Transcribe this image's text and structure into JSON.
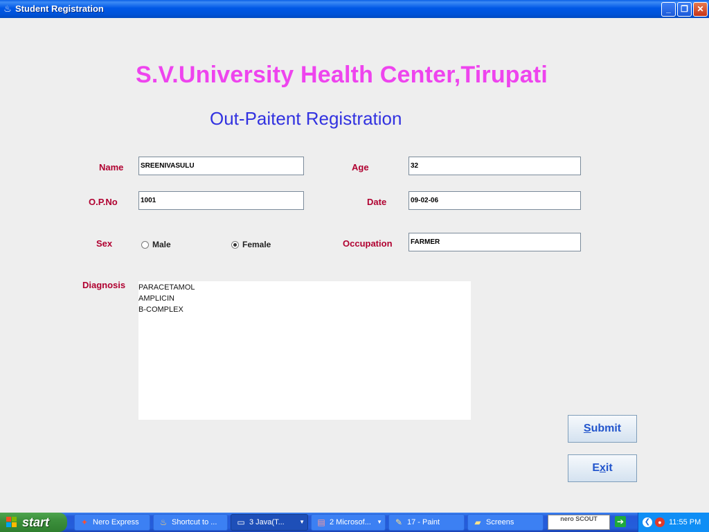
{
  "window": {
    "title": "Student Registration",
    "controls": {
      "minimize": "_",
      "maximize": "❐",
      "close": "✕"
    }
  },
  "form": {
    "heading": "S.V.University Health Center,Tirupati",
    "subheading": "Out-Paitent Registration",
    "labels": {
      "name": "Name",
      "age": "Age",
      "opno": "O.P.No",
      "date": "Date",
      "sex": "Sex",
      "occupation": "Occupation",
      "diagnosis": "Diagnosis"
    },
    "values": {
      "name": "SREENIVASULU",
      "age": "32",
      "opno": "1001",
      "date": "09-02-06",
      "occupation": "FARMER"
    },
    "sex_options": [
      {
        "label": "Male",
        "selected": false
      },
      {
        "label": "Female",
        "selected": true
      }
    ],
    "diagnosis_lines": [
      "PARACETAMOL",
      "AMPLICIN",
      "B-COMPLEX"
    ],
    "buttons": {
      "submit": {
        "mnemonic": "S",
        "rest": "ubmit"
      },
      "exit": {
        "pre": "E",
        "mnemonic": "x",
        "rest": "it"
      }
    },
    "colors": {
      "heading": "#ee44ee",
      "subheading": "#3232e0",
      "labels": "#b00030",
      "buttons": "#2255cc"
    }
  },
  "taskbar": {
    "start_label": "start",
    "tasks": [
      {
        "label": "Nero Express",
        "icon": "nero-icon",
        "active": false
      },
      {
        "label": "Shortcut to ...",
        "icon": "java-icon",
        "active": false
      },
      {
        "label": "3 Java(T...",
        "icon": "window-icon",
        "active": true,
        "dropdown": true
      },
      {
        "label": "2 Microsof...",
        "icon": "word-icon",
        "active": false,
        "dropdown": true
      },
      {
        "label": "17 - Paint",
        "icon": "paint-icon",
        "active": false
      },
      {
        "label": "Screens",
        "icon": "folder-icon",
        "active": false
      }
    ],
    "nero_scout_label": "nero SCOUT",
    "clock": "11:55 PM"
  }
}
